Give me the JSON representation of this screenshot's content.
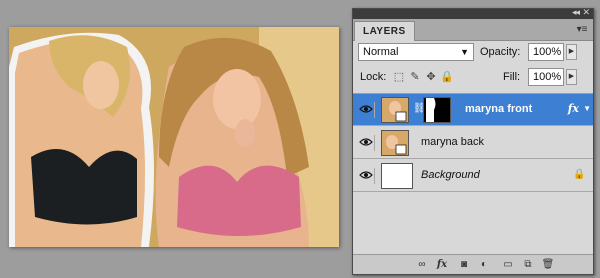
{
  "panel": {
    "tab_label": "LAYERS",
    "blend_mode": "Normal",
    "opacity_label": "Opacity:",
    "opacity_value": "100%",
    "lock_label": "Lock:",
    "fill_label": "Fill:",
    "fill_value": "100%"
  },
  "layers": [
    {
      "name": "maryna front",
      "selected": true,
      "has_mask": true,
      "fx": "fx"
    },
    {
      "name": "maryna back",
      "selected": false
    },
    {
      "name": "Background",
      "selected": false,
      "locked": true
    }
  ],
  "colors": {
    "selection": "#3d7fd2",
    "panel_bg": "#d8d8d8",
    "workspace_bg": "#9d9d9d"
  },
  "icons": {
    "lock_options": [
      "lock-transparent-icon",
      "lock-paint-icon",
      "lock-move-icon",
      "lock-all-icon"
    ],
    "bottom_bar": [
      "link-layers-icon",
      "add-style-icon",
      "add-mask-icon",
      "adjustment-layer-icon",
      "new-group-icon",
      "new-layer-icon",
      "delete-layer-icon"
    ]
  }
}
